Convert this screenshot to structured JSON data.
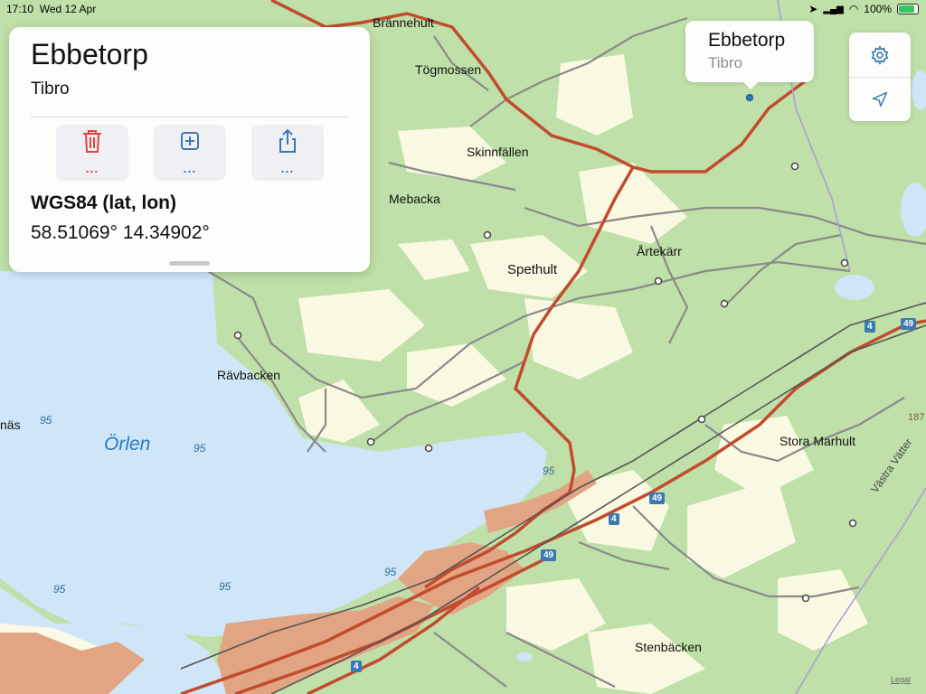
{
  "status_bar": {
    "time": "17:10",
    "date": "Wed 12 Apr",
    "battery": "100%"
  },
  "info_card": {
    "title": "Ebbetorp",
    "subtitle": "Tibro",
    "buttons": [
      {
        "name": "delete-button",
        "icon": "trash-icon",
        "color": "#e0443a",
        "dots": "..."
      },
      {
        "name": "add-button",
        "icon": "plus-square-icon",
        "color": "#3b79b3",
        "dots": "..."
      },
      {
        "name": "share-button",
        "icon": "share-icon",
        "color": "#3b79b3",
        "dots": "..."
      }
    ],
    "coord_label": "WGS84 (lat, lon)",
    "coord_value": "58.51069° 14.34902°"
  },
  "callout": {
    "title": "Ebbetorp",
    "subtitle": "Tibro"
  },
  "controls": {
    "settings_icon": "gear-icon",
    "location_icon": "location-arrow-icon"
  },
  "map": {
    "place_labels": {
      "brannehult": "Brännehult",
      "togmossen": "Tögmossen",
      "skinnfallen": "Skinnfällen",
      "mebacka": "Mebacka",
      "spethult": "Spethult",
      "artekarr": "Årtekärr",
      "ravbacken": "Rävbacken",
      "stora_marhult": "Stora Marhult",
      "stenbacken": "Stenbäcken",
      "nas": "näs"
    },
    "water_label": "Örlen",
    "road_label": "Västra Vätter",
    "depths": [
      "95",
      "95",
      "95",
      "95",
      "95",
      "95",
      "95"
    ],
    "road_shields": [
      "49",
      "49",
      "49",
      "4",
      "4",
      "4"
    ],
    "contour_label": "187",
    "colors": {
      "water": "#cfe6f8",
      "forest": "#bfe0a8",
      "open_land": "#fdfbe6",
      "urban": "#e2a583",
      "main_road": "#c24b2e",
      "minor_road": "#888888"
    }
  },
  "legal_link": "Legal"
}
